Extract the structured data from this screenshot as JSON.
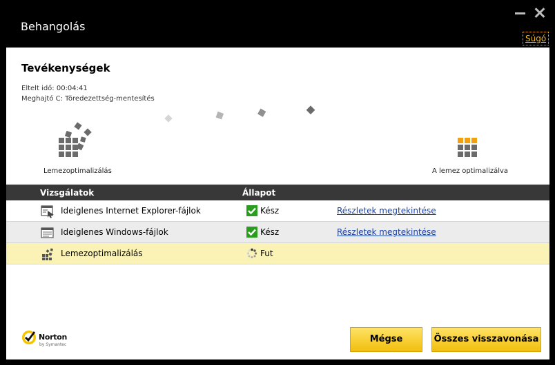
{
  "window": {
    "title": "Behangolás",
    "help_label": "Súgó"
  },
  "activity": {
    "title": "Tevékenységek",
    "elapsed": "Eltelt idő: 00:04:41",
    "drive": "Meghajtó C: Töredezettség-mentesítés",
    "start_label": "Lemezoptimalizálás",
    "end_label": "A lemez optimalizálva"
  },
  "table": {
    "headers": {
      "scan": "Vizsgálatok",
      "status": "Állapot"
    },
    "rows": [
      {
        "name": "Ideiglenes Internet Explorer-fájlok",
        "status": "Kész",
        "details": "Részletek megtekintése",
        "icon": "ie-files-icon",
        "status_icon": "checkmark-icon"
      },
      {
        "name": "Ideiglenes Windows-fájlok",
        "status": "Kész",
        "details": "Részletek megtekintése",
        "icon": "windows-files-icon",
        "status_icon": "checkmark-icon"
      },
      {
        "name": "Lemezoptimalizálás",
        "status": "Fut",
        "details": "",
        "icon": "disk-optimize-icon",
        "status_icon": "spinner-icon"
      }
    ]
  },
  "footer": {
    "brand": "Norton",
    "brand_sub": "by Symantec",
    "cancel_label": "Mégse",
    "undo_label": "Összes visszavonása"
  },
  "colors": {
    "accent": "#f5b70a",
    "header_bg": "#383838",
    "running_row": "#fbf3b6",
    "check_green": "#2a9d1f",
    "link": "#1a43a8"
  }
}
